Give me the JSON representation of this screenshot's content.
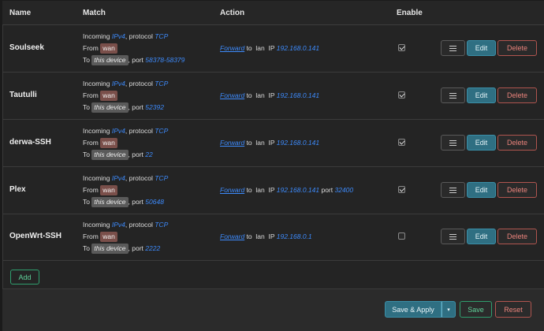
{
  "columns": {
    "name": "Name",
    "match": "Match",
    "action": "Action",
    "enable": "Enable"
  },
  "buttons": {
    "edit": "Edit",
    "delete": "Delete",
    "menu_icon": "menu-icon"
  },
  "rules": [
    {
      "name": "Soulseek",
      "family": "IPv4",
      "protocol": "TCP",
      "src_zone": "wan",
      "dest": "this device",
      "port": "58378-58379",
      "action": "Forward",
      "to_zone": "lan",
      "ip": "192.168.0.141",
      "dest_port": "",
      "enabled": true
    },
    {
      "name": "Tautulli",
      "family": "IPv4",
      "protocol": "TCP",
      "src_zone": "wan",
      "dest": "this device",
      "port": "52392",
      "action": "Forward",
      "to_zone": "lan",
      "ip": "192.168.0.141",
      "dest_port": "",
      "enabled": true
    },
    {
      "name": "derwa-SSH",
      "family": "IPv4",
      "protocol": "TCP",
      "src_zone": "wan",
      "dest": "this device",
      "port": "22",
      "action": "Forward",
      "to_zone": "lan",
      "ip": "192.168.0.141",
      "dest_port": "",
      "enabled": true
    },
    {
      "name": "Plex",
      "family": "IPv4",
      "protocol": "TCP",
      "src_zone": "wan",
      "dest": "this device",
      "port": "50648",
      "action": "Forward",
      "to_zone": "lan",
      "ip": "192.168.0.141",
      "dest_port": "32400",
      "enabled": true
    },
    {
      "name": "OpenWrt-SSH",
      "family": "IPv4",
      "protocol": "TCP",
      "src_zone": "wan",
      "dest": "this device",
      "port": "2222",
      "action": "Forward",
      "to_zone": "lan",
      "ip": "192.168.0.1",
      "dest_port": "",
      "enabled": false
    }
  ],
  "text": {
    "incoming": "Incoming",
    "protocol": ", protocol",
    "from": "From",
    "to": "To",
    "port": ", port",
    "to_word": "to",
    "ip_word": "IP",
    "port_word": "port"
  },
  "add_label": "Add",
  "footer": {
    "save_apply": "Save & Apply",
    "save": "Save",
    "reset": "Reset"
  }
}
